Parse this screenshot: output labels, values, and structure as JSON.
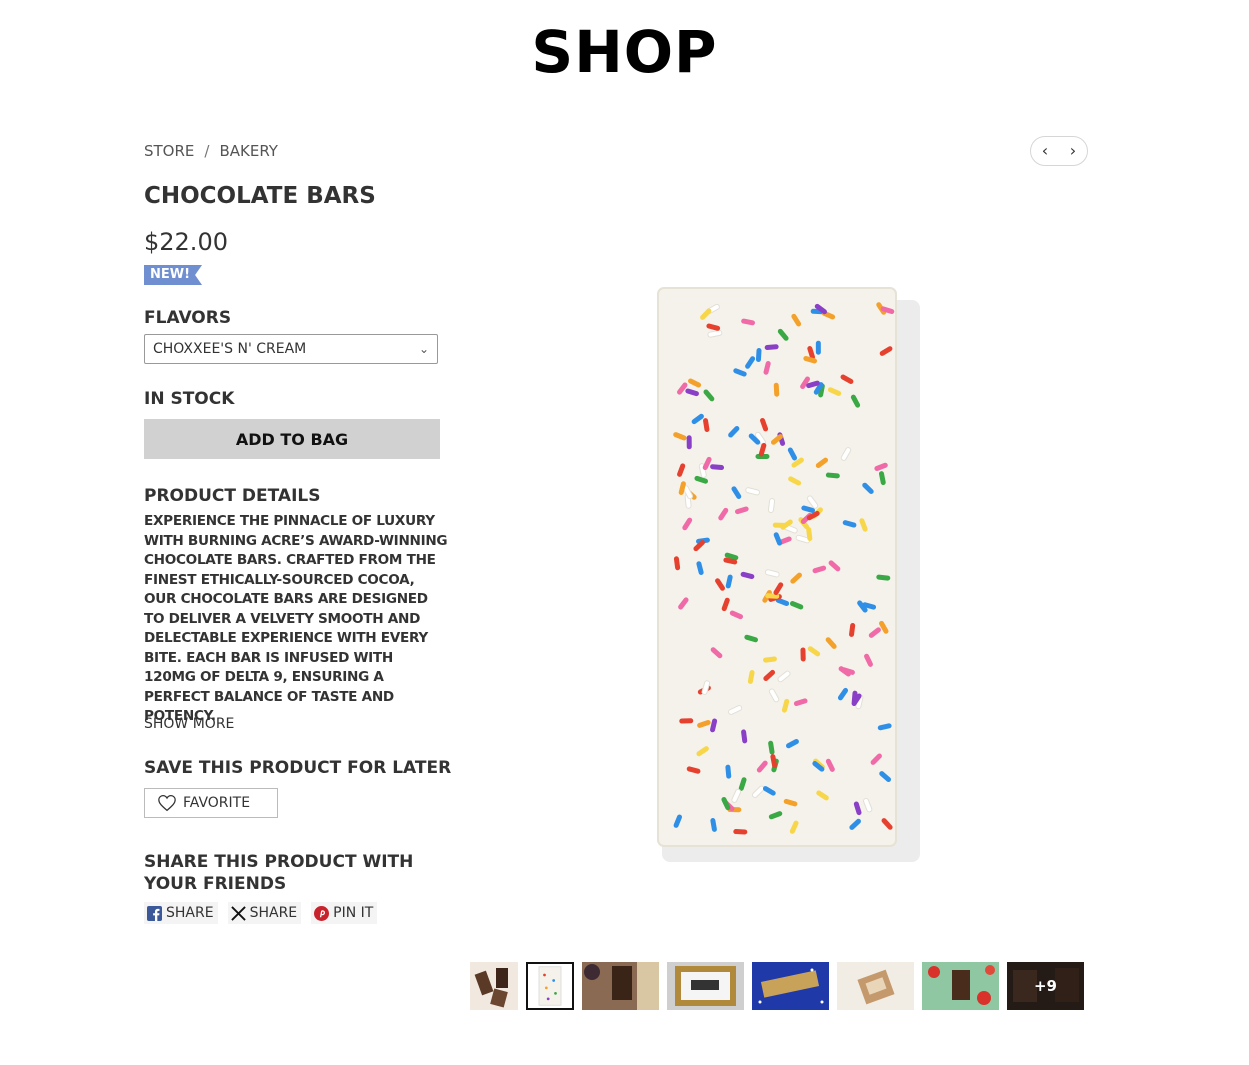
{
  "header": {
    "title": "SHOP"
  },
  "breadcrumb": {
    "items": [
      "STORE",
      "BAKERY"
    ],
    "separator": "/"
  },
  "pager": {
    "prev_icon": "chevron-left-icon",
    "next_icon": "chevron-right-icon"
  },
  "product": {
    "title": "CHOCOLATE BARS",
    "price": "$22.00",
    "badge": "NEW!",
    "flavors_label": "FLAVORS",
    "flavor_selected": "CHOXXEE'S N' CREAM",
    "stock": "IN STOCK",
    "add_to_bag": "ADD TO BAG",
    "details_label": "PRODUCT DETAILS",
    "details_text": "EXPERIENCE THE PINNACLE OF LUXURY WITH BURNING ACRE’S AWARD-WINNING CHOCOLATE BARS. CRAFTED FROM THE FINEST ETHICALLY-SOURCED COCOA, OUR CHOCOLATE BARS ARE DESIGNED TO DELIVER A VELVETY SMOOTH AND DELECTABLE EXPERIENCE WITH EVERY BITE. EACH BAR IS INFUSED WITH 120MG OF DELTA 9, ENSURING A PERFECT BALANCE OF TASTE AND POTENCY.",
    "show_more": "SHOW MORE"
  },
  "save": {
    "label": "SAVE THIS PRODUCT FOR LATER",
    "favorite": "FAVORITE"
  },
  "share": {
    "label": "SHARE THIS PRODUCT WITH YOUR FRIENDS",
    "facebook": "SHARE",
    "x": "SHARE",
    "pinterest": "PIN IT"
  },
  "thumbnails": {
    "more_count": "+9"
  },
  "colors": {
    "badge": "#6f8fd0",
    "button": "#d1d1d1",
    "facebook": "#3b5998",
    "pinterest": "#c8232c"
  }
}
